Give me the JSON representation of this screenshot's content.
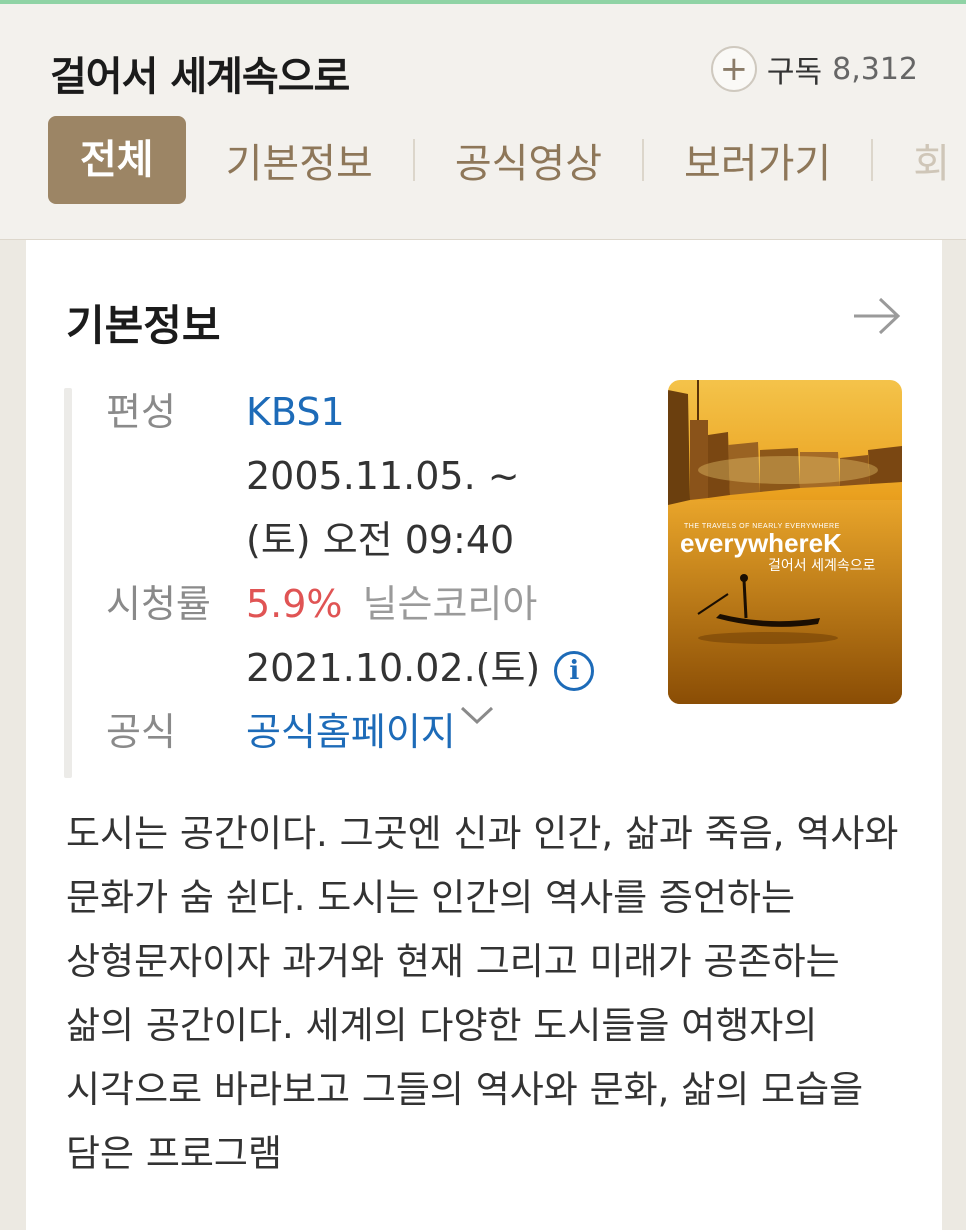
{
  "header": {
    "title": "걸어서 세계속으로",
    "subscribe_label": "구독",
    "subscribe_count": "8,312",
    "tabs": [
      {
        "label": "전체",
        "active": true
      },
      {
        "label": "기본정보"
      },
      {
        "label": "공식영상"
      },
      {
        "label": "보러가기"
      },
      {
        "label": "회"
      }
    ]
  },
  "card": {
    "section_title": "기본정보",
    "info": {
      "broadcast_label": "편성",
      "broadcast_channel": "KBS1",
      "broadcast_period": "2005.11.05. ~",
      "broadcast_time": "(토) 오전 09:40",
      "rating_label": "시청률",
      "rating_value": "5.9%",
      "rating_source": "닐슨코리아",
      "rating_date": "2021.10.02.(토)",
      "official_label": "공식",
      "official_link": "공식홈페이지"
    },
    "poster": {
      "small_text": "THE TRAVELS OF NEARLY EVERYWHERE",
      "logo_text": "everywhereK",
      "korean_title": "걸어서 세계속으로"
    },
    "description": "도시는 공간이다. 그곳엔 신과 인간, 삶과 죽음, 역사와 문화가 숨 쉰다. 도시는 인간의 역사를 증언하는 상형문자이자 과거와 현재 그리고 미래가 공존하는 삶의 공간이다. 세계의 다양한 도시들을 여행자의 시각으로 바라보고 그들의 역사와 문화, 삶의 모습을 담은 프로그램"
  },
  "colors": {
    "accent": "#9c8565",
    "link": "#1d6bb8",
    "rating": "#e05454"
  }
}
